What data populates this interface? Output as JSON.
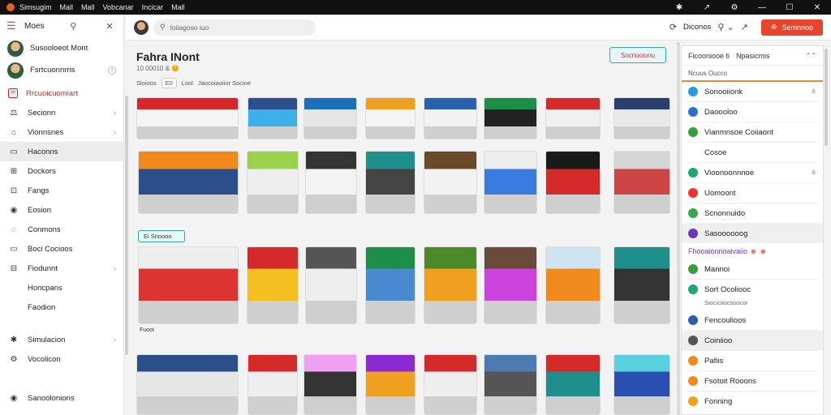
{
  "titlebar": {
    "tabs": [
      "Simsugim",
      "Mall",
      "Mall",
      "Vobcanar",
      "Incicar",
      "Mall"
    ],
    "controls": [
      "✱",
      "↗",
      "⚙",
      "—",
      "☐",
      "✕"
    ]
  },
  "sidebar": {
    "header": "Moes",
    "users": [
      {
        "name": "Susooloeot Mont"
      },
      {
        "name": "Fsrtcuonnrris"
      }
    ],
    "items": [
      {
        "label": "Rrcuoicuomiart",
        "icon": "✉",
        "chev": ""
      },
      {
        "label": "Secionn",
        "icon": "⚖",
        "chev": "›"
      },
      {
        "label": "Vionnsnes",
        "icon": "⌂",
        "chev": "›"
      },
      {
        "label": "Haconns",
        "icon": "▭",
        "chev": ""
      },
      {
        "label": "Dockors",
        "icon": "⊞",
        "chev": ""
      },
      {
        "label": "Fangs",
        "icon": "⊡",
        "chev": ""
      },
      {
        "label": "Eosion",
        "icon": "◉",
        "chev": ""
      },
      {
        "label": "Conmons",
        "icon": "◌",
        "chev": ""
      },
      {
        "label": "Boci Cocioos",
        "icon": "▭",
        "chev": ""
      },
      {
        "label": "Fiodunnt",
        "icon": "⊟",
        "chev": "›"
      },
      {
        "label": "Honcpans",
        "icon": "",
        "chev": ""
      },
      {
        "label": "Faodion",
        "icon": "",
        "chev": ""
      },
      {
        "label": "Simulacion",
        "icon": "✱",
        "chev": "›"
      },
      {
        "label": "Vocolicon",
        "icon": "⚙",
        "chev": ""
      },
      {
        "label": "Sanoolonions",
        "icon": "◉",
        "chev": ""
      }
    ]
  },
  "topbar": {
    "search_placeholder": "Ioiiagoso iuo",
    "label": "Diconos",
    "cta_label": "Semnnoo"
  },
  "content": {
    "title": "Fahra INont",
    "subtitle": "10 00010 & 😊",
    "chips": [
      "Sloioos",
      "E0",
      "Lool",
      "Jaocoiaoiior Socioe"
    ],
    "outline_button": "Socriooionu",
    "tag": "Ei Snoooo",
    "tag2": "Fuoot"
  },
  "right_panel": {
    "header": "Ficooniooe ti",
    "header2": "Npasicmis",
    "subheader": "Ncuus Oucco",
    "items": [
      {
        "label": "Sonooiionk",
        "color": "#2a9bd6",
        "end": "≛",
        "sel": false
      },
      {
        "label": "Daoooloo",
        "color": "#2c6fd1",
        "end": "",
        "sel": false
      },
      {
        "label": "Vianmnsoe Coiiaont",
        "color": "#3a9d3a",
        "end": "",
        "sel": false
      },
      {
        "label": "Cosoe",
        "color": "",
        "end": "",
        "sel": false
      },
      {
        "label": "Vioonoonnnoe",
        "color": "#1fa37a",
        "end": "≛",
        "sel": false
      },
      {
        "label": "Uomoont",
        "color": "#e33",
        "end": "",
        "sel": false
      },
      {
        "label": "Scnonnuido",
        "color": "#3aa84a",
        "end": "",
        "sel": false
      },
      {
        "label": "Sasoooooog",
        "color": "#6a3ab5",
        "end": "",
        "sel": true
      }
    ],
    "section": "Fhooaionnoaivaiio",
    "items2": [
      {
        "label": "Mannoi",
        "color": "#3a9d3a",
        "sel": false
      },
      {
        "label": "Sort Ocoliooc",
        "color": "#1fa37a",
        "sel": false
      }
    ],
    "small": "Siociciiocsoocoi",
    "items3": [
      {
        "label": "Fencoulioos",
        "color": "#2c5cb0",
        "sel": false
      },
      {
        "label": "Coiniioo",
        "color": "#555",
        "sel": true
      },
      {
        "label": "Pafiis",
        "color": "#f08a1c",
        "sel": false
      },
      {
        "label": "Fsotoit Rooons",
        "color": "#f08a1c",
        "sel": false
      },
      {
        "label": "Fonning",
        "color": "#f0a01c",
        "sel": false
      }
    ]
  }
}
